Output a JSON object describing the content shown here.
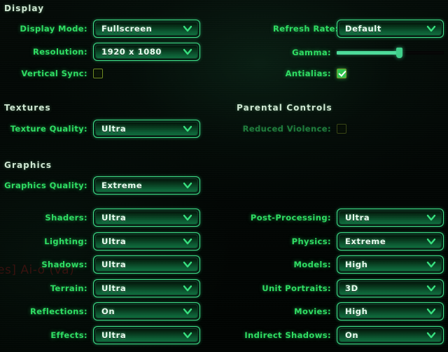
{
  "theme": {
    "accent_green": "#2fdd63",
    "value_text": "#e8fff0",
    "header_text": "#cfe6d2",
    "border_green": "#3fe089",
    "background": "#020604",
    "checkbox_border": "#6f8a22",
    "checkbox_checked_fill": "#2fc44f",
    "slider_fill": "#4ddb9a",
    "disabled_green": "#1f7c3c"
  },
  "background_ghost_text": "es] Ai-o (va)",
  "icons": {
    "chevron_down": "chevron-down-icon",
    "checkmark": "checkmark-icon"
  },
  "sections": {
    "display": {
      "title": "Display",
      "rows": [
        {
          "label": "Display Mode:",
          "value": "Fullscreen",
          "control": "dropdown"
        },
        {
          "label": "Resolution:",
          "value": "1920 x 1080",
          "control": "dropdown"
        },
        {
          "label": "Vertical Sync:",
          "value": "off",
          "control": "checkbox"
        },
        {
          "label": "Refresh Rate:",
          "value": "Default",
          "control": "dropdown"
        },
        {
          "label": "Gamma:",
          "value": "58",
          "control": "slider"
        },
        {
          "label": "Antialias:",
          "value": "on",
          "control": "checkbox"
        }
      ]
    },
    "textures": {
      "title": "Textures",
      "rows": [
        {
          "label": "Texture Quality:",
          "value": "Ultra",
          "control": "dropdown"
        }
      ]
    },
    "parental_controls": {
      "title": "Parental Controls",
      "rows": [
        {
          "label": "Reduced Violence:",
          "value": "off",
          "control": "checkbox",
          "disabled": true
        }
      ]
    },
    "graphics": {
      "title": "Graphics",
      "quality": {
        "label": "Graphics Quality:",
        "value": "Extreme",
        "control": "dropdown"
      },
      "left_rows": [
        {
          "label": "Shaders:",
          "value": "Ultra",
          "control": "dropdown"
        },
        {
          "label": "Lighting:",
          "value": "Ultra",
          "control": "dropdown"
        },
        {
          "label": "Shadows:",
          "value": "Ultra",
          "control": "dropdown"
        },
        {
          "label": "Terrain:",
          "value": "Ultra",
          "control": "dropdown"
        },
        {
          "label": "Reflections:",
          "value": "On",
          "control": "dropdown"
        },
        {
          "label": "Effects:",
          "value": "Ultra",
          "control": "dropdown"
        }
      ],
      "right_rows": [
        {
          "label": "Post-Processing:",
          "value": "Ultra",
          "control": "dropdown"
        },
        {
          "label": "Physics:",
          "value": "Extreme",
          "control": "dropdown"
        },
        {
          "label": "Models:",
          "value": "High",
          "control": "dropdown"
        },
        {
          "label": "Unit Portraits:",
          "value": "3D",
          "control": "dropdown"
        },
        {
          "label": "Movies:",
          "value": "High",
          "control": "dropdown"
        },
        {
          "label": "Indirect Shadows:",
          "value": "On",
          "control": "dropdown"
        }
      ]
    }
  }
}
